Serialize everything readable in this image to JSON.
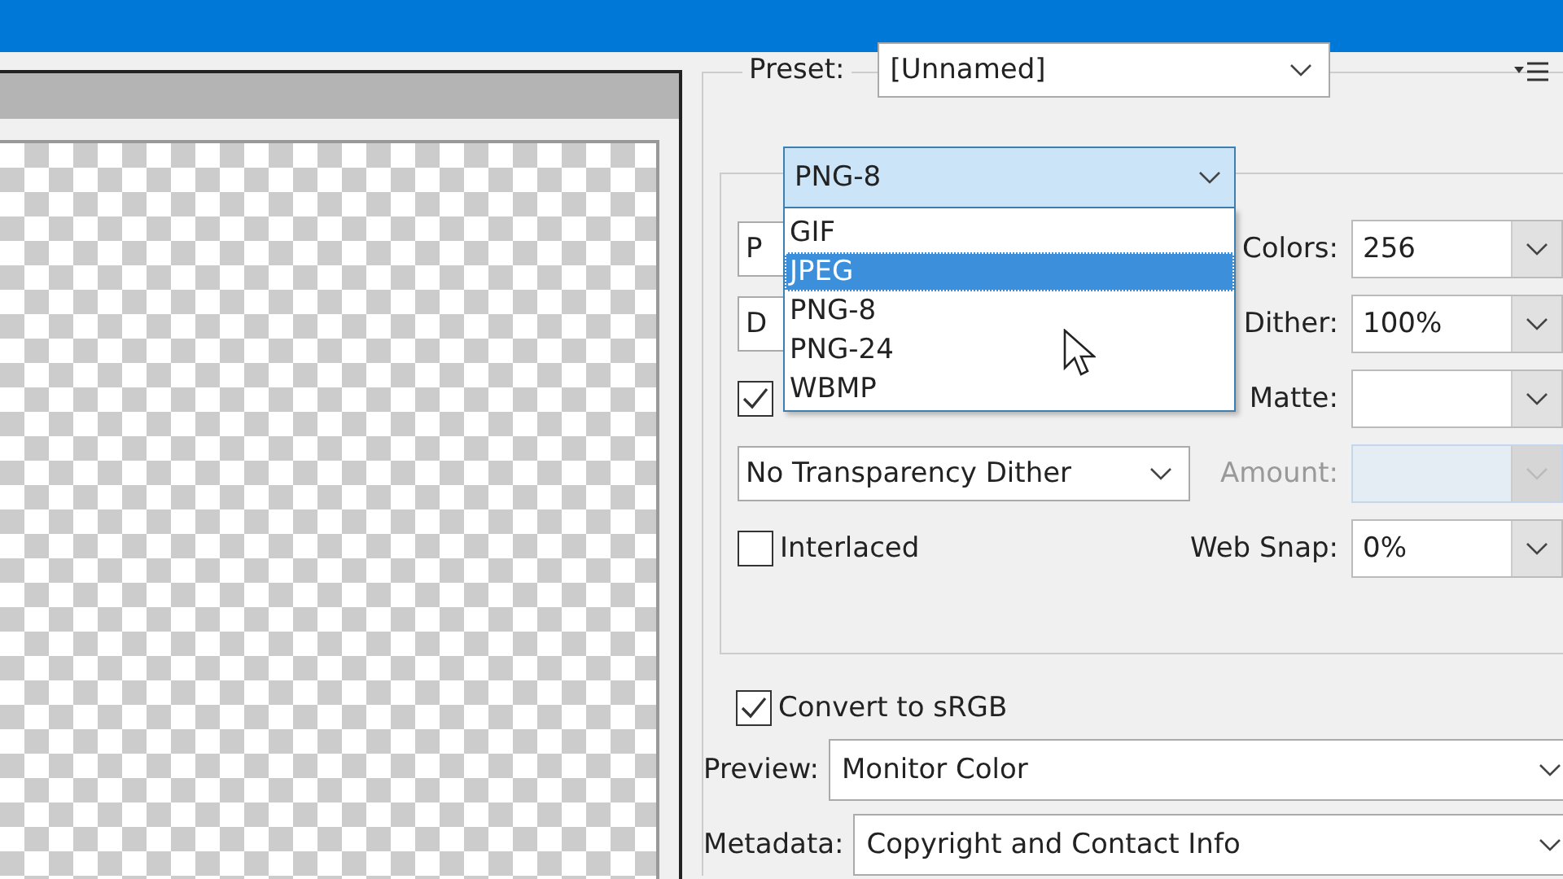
{
  "preset": {
    "label": "Preset:",
    "value": "[Unnamed]"
  },
  "format": {
    "value": "PNG-8",
    "expanded": true,
    "options": [
      {
        "label": "GIF",
        "highlighted": false
      },
      {
        "label": "JPEG",
        "highlighted": true
      },
      {
        "label": "PNG-8",
        "highlighted": false
      },
      {
        "label": "PNG-24",
        "highlighted": false
      },
      {
        "label": "WBMP",
        "highlighted": false
      }
    ]
  },
  "rows": [
    {
      "left": {
        "kind": "covered_select",
        "value": "P"
      },
      "label": "Colors:",
      "field": {
        "value": "256",
        "disabled": false
      }
    },
    {
      "left": {
        "kind": "covered_select",
        "value": "D"
      },
      "label": "Dither:",
      "field": {
        "value": "100%",
        "disabled": false
      }
    },
    {
      "left": {
        "kind": "checkbox",
        "checked": true
      },
      "label": "Matte:",
      "field": {
        "disabled": false
      }
    },
    {
      "left": {
        "kind": "select",
        "value": "No Transparency Dither"
      },
      "label": "Amount:",
      "field": {
        "disabled": true
      }
    },
    {
      "left": {
        "kind": "checkbox",
        "label": "Interlaced",
        "checked": false
      },
      "label": "Web Snap:",
      "field": {
        "value": "0%",
        "disabled": false
      }
    }
  ],
  "convert": {
    "label": "Convert to sRGB",
    "checked": true
  },
  "preview": {
    "label": "Preview:",
    "value": "Monitor Color"
  },
  "metadata": {
    "label": "Metadata:",
    "value": "Copyright and Contact Info"
  }
}
